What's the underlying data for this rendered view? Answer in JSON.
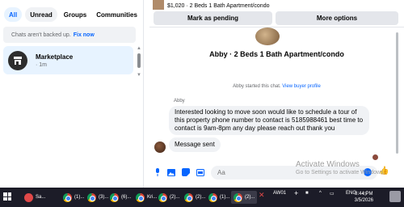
{
  "filters": [
    {
      "label": "All",
      "active": true
    },
    {
      "label": "Unread",
      "active": false
    },
    {
      "label": "Groups",
      "active": false
    },
    {
      "label": "Communities",
      "active": false
    }
  ],
  "backup": {
    "text": "Chats aren't backed up.",
    "link": "Fix now"
  },
  "chat_list": [
    {
      "name": "Marketplace",
      "time": "· 1m",
      "icon": "store-icon"
    }
  ],
  "conversation": {
    "header_price": "$1,020 · 2 Beds 1 Bath Apartment/condo",
    "buttons": {
      "pending": "Mark as pending",
      "more": "More options"
    },
    "listing_title": "Abby · 2 Beds 1 Bath Apartment/condo",
    "started_text": "Abby started this chat.",
    "started_link": "View buyer profile",
    "sender": "Abby",
    "messages": [
      "Interested looking to move soon would like to schedule a tour of this property phone number to contact is 5185988461 best time to contact is 9am-8pm any day please reach out thank you",
      "Message sent"
    ],
    "composer_placeholder": "Aa"
  },
  "watermark": {
    "line1": "Activate Windows",
    "line2": "Go to Settings to activate Windows."
  },
  "taskbar": {
    "items": [
      "Sa...",
      "(1)...",
      "(3)...",
      "(6)...",
      "Kri...",
      "(2)...",
      "(2)...",
      "(1)...",
      "(2)..."
    ],
    "app_label": "AW01",
    "lang": "ENG",
    "time": "8:44 PM",
    "date": "3/5/2026"
  },
  "colors": {
    "accent": "#0866ff",
    "chip_active_bg": "#e7f3ff",
    "taskbar": "#1c1c28"
  }
}
